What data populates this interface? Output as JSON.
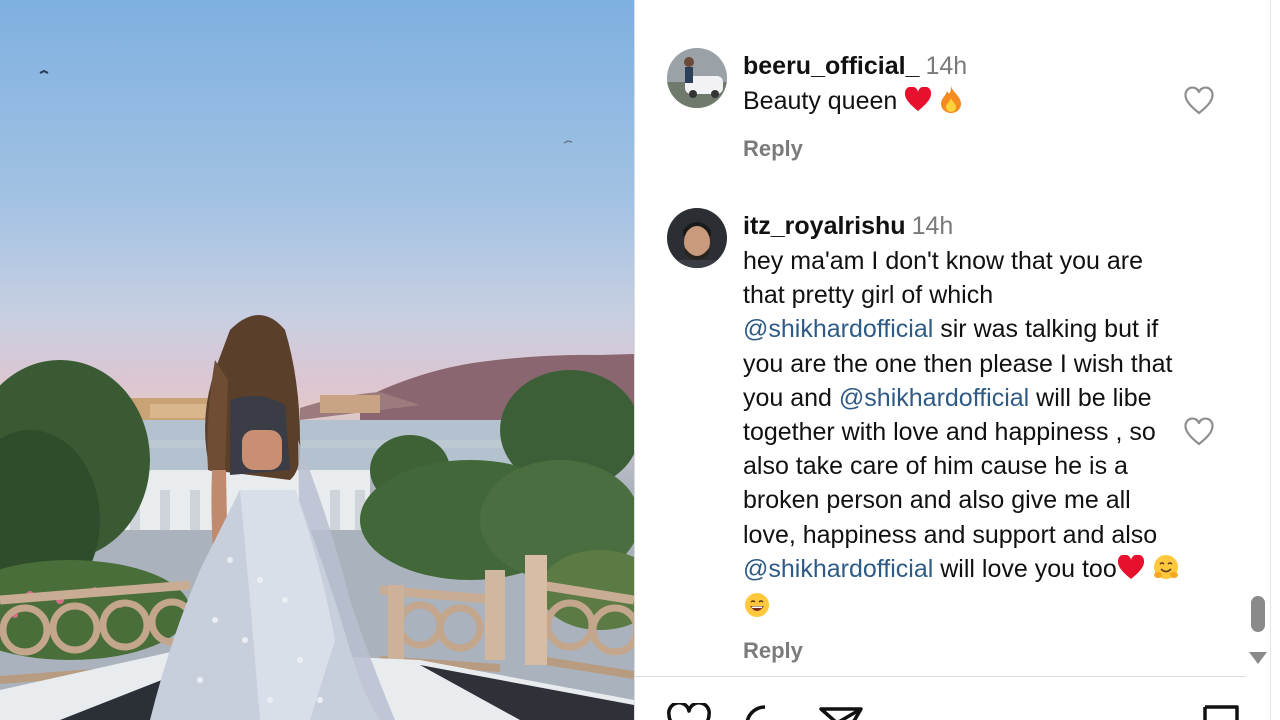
{
  "post": {
    "image_alt": "Woman in a silver lehenga standing on a terrace overlooking a lake palace at sunset"
  },
  "comments": [
    {
      "username": "beeru_official_",
      "time": "14h",
      "text_prefix": "Beauty queen ",
      "emojis": [
        "red-heart-emoji",
        "fire-emoji"
      ],
      "reply_label": "Reply"
    },
    {
      "username": "itz_royalrishu",
      "time": "14h",
      "segments": [
        {
          "type": "text",
          "value": "hey ma'am I don't know that you are that pretty girl of which "
        },
        {
          "type": "mention",
          "value": "@shikhardofficial"
        },
        {
          "type": "text",
          "value": " sir was talking but if you are the one then please I wish that you and "
        },
        {
          "type": "mention",
          "value": "@shikhardofficial"
        },
        {
          "type": "text",
          "value": " will be libe together with love and happiness , so also take care of him cause he is a broken person and also give me all love, happiness and support and also "
        },
        {
          "type": "mention",
          "value": "@shikhardofficial"
        },
        {
          "type": "text",
          "value": " will love you too"
        }
      ],
      "emojis": [
        "red-heart-emoji",
        "hugging-emoji",
        "grinning-emoji"
      ],
      "reply_label": "Reply"
    }
  ],
  "colors": {
    "mention": "#2e5a86",
    "secondary_text": "#7a7a7a",
    "heart_red": "#e8112d",
    "scrollbar": "#8a8a8a"
  },
  "action_bar": {
    "icons": [
      "like-heart-icon",
      "comment-icon",
      "share-icon",
      "save-bookmark-icon"
    ]
  }
}
